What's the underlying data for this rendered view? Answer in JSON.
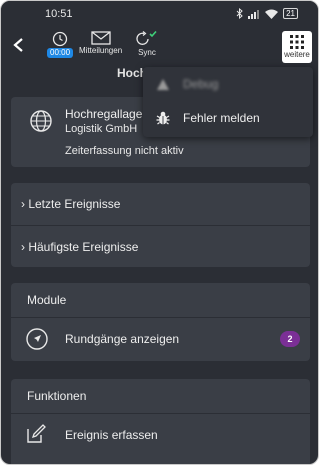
{
  "status_bar": {
    "time": "10:51",
    "battery": "21"
  },
  "app_bar": {
    "timer_value": "00:00",
    "messages_label": "Mitteilungen",
    "sync_label": "Sync",
    "more_label": "weitere"
  },
  "page": {
    "title": "Hoch"
  },
  "company": {
    "name_line1": "Hochregallage",
    "name_line2": "Logistik GmbH",
    "time_tracking_status": "Zeiterfassung nicht aktiv"
  },
  "events": {
    "items": [
      {
        "label": "Letzte Ereignisse"
      },
      {
        "label": "Häufigste Ereignisse"
      }
    ]
  },
  "modules": {
    "title": "Module",
    "items": [
      {
        "label": "Rundgänge anzeigen",
        "badge": "2"
      }
    ]
  },
  "functions": {
    "title": "Funktionen",
    "items": [
      {
        "label": "Ereignis erfassen"
      }
    ]
  },
  "popup_menu": {
    "items": [
      {
        "label": "Debug"
      },
      {
        "label": "Fehler melden"
      }
    ]
  },
  "colors": {
    "background": "#2b2e35",
    "card": "#3a3e46",
    "accent_blue": "#1e88e5",
    "sync_check": "#3fd07a",
    "badge": "#7b2f96"
  }
}
